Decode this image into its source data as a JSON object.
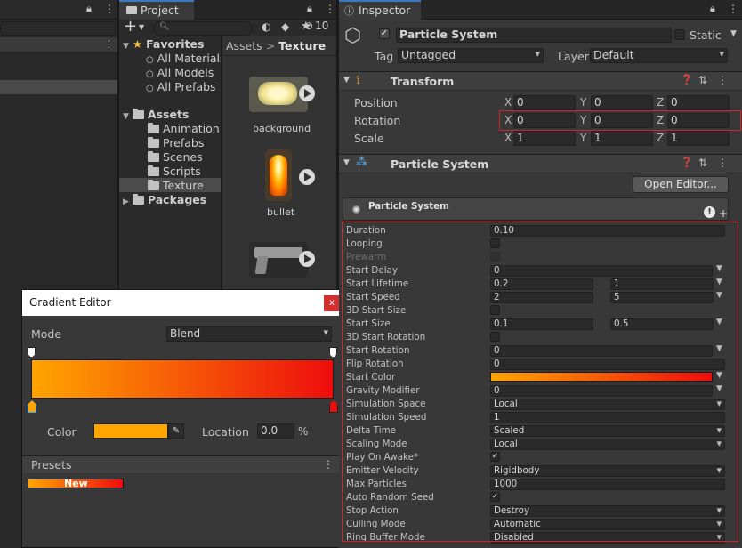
{
  "hierarchy": {},
  "project": {
    "tab_title": "Project",
    "add_label": "+",
    "hidden_count": "10",
    "favorites": {
      "label": "Favorites",
      "items": [
        "All Materials",
        "All Models",
        "All Prefabs"
      ]
    },
    "assets": {
      "label": "Assets",
      "items": [
        "Animation",
        "Prefabs",
        "Scenes",
        "Scripts",
        "Texture"
      ]
    },
    "packages_label": "Packages",
    "breadcrumb": {
      "root": "Assets",
      "sep": ">",
      "current": "Texture"
    },
    "thumbnails": [
      {
        "label": "background"
      },
      {
        "label": "bullet"
      },
      {
        "label": ""
      }
    ]
  },
  "inspector": {
    "tab_title": "Inspector",
    "object_name": "Particle System",
    "static_label": "Static",
    "tag_label": "Tag",
    "tag_value": "Untagged",
    "layer_label": "Layer",
    "layer_value": "Default",
    "transform": {
      "title": "Transform",
      "rows": [
        {
          "label": "Position",
          "x": "0",
          "y": "0",
          "z": "0"
        },
        {
          "label": "Rotation",
          "x": "0",
          "y": "0",
          "z": "0"
        },
        {
          "label": "Scale",
          "x": "1",
          "y": "1",
          "z": "1"
        }
      ],
      "axis": {
        "x": "X",
        "y": "Y",
        "z": "Z"
      }
    },
    "particle_system": {
      "title": "Particle System",
      "open_editor_label": "Open Editor...",
      "module_title": "Particle System",
      "props": [
        {
          "label": "Duration",
          "kind": "field",
          "value": "0.10"
        },
        {
          "label": "Looping",
          "kind": "check",
          "checked": false
        },
        {
          "label": "Prewarm",
          "kind": "check",
          "checked": false,
          "disabled": true
        },
        {
          "label": "Start Delay",
          "kind": "field-dd",
          "value": "0"
        },
        {
          "label": "Start Lifetime",
          "kind": "two",
          "a": "0.2",
          "b": "1"
        },
        {
          "label": "Start Speed",
          "kind": "two",
          "a": "2",
          "b": "5"
        },
        {
          "label": "3D Start Size",
          "kind": "check",
          "checked": false
        },
        {
          "label": "Start Size",
          "kind": "two",
          "a": "0.1",
          "b": "0.5"
        },
        {
          "label": "3D Start Rotation",
          "kind": "check",
          "checked": false
        },
        {
          "label": "Start Rotation",
          "kind": "field-dd",
          "value": "0"
        },
        {
          "label": "Flip Rotation",
          "kind": "field",
          "value": "0"
        },
        {
          "label": "Start Color",
          "kind": "gradient"
        },
        {
          "label": "Gravity Modifier",
          "kind": "field-dd",
          "value": "0"
        },
        {
          "label": "Simulation Space",
          "kind": "dropdown",
          "value": "Local"
        },
        {
          "label": "Simulation Speed",
          "kind": "field",
          "value": "1"
        },
        {
          "label": "Delta Time",
          "kind": "dropdown",
          "value": "Scaled"
        },
        {
          "label": "Scaling Mode",
          "kind": "dropdown",
          "value": "Local"
        },
        {
          "label": "Play On Awake*",
          "kind": "check",
          "checked": true
        },
        {
          "label": "Emitter Velocity",
          "kind": "dropdown",
          "value": "Rigidbody"
        },
        {
          "label": "Max Particles",
          "kind": "field",
          "value": "1000"
        },
        {
          "label": "Auto Random Seed",
          "kind": "check",
          "checked": true
        },
        {
          "label": "Stop Action",
          "kind": "dropdown",
          "value": "Destroy"
        },
        {
          "label": "Culling Mode",
          "kind": "dropdown",
          "value": "Automatic"
        },
        {
          "label": "Ring Buffer Mode",
          "kind": "dropdown",
          "value": "Disabled"
        }
      ]
    }
  },
  "gradient_editor": {
    "title": "Gradient Editor",
    "close_label": "x",
    "mode_label": "Mode",
    "mode_value": "Blend",
    "color_label": "Color",
    "location_label": "Location",
    "location_value": "0.0",
    "percent_label": "%",
    "presets_label": "Presets",
    "preset_new_label": "New"
  },
  "colors": {
    "accent_tab": "#3a79bb",
    "highlight_red": "#d0262a",
    "gradient_start": "#ffa500",
    "gradient_end": "#ee0d0d"
  }
}
